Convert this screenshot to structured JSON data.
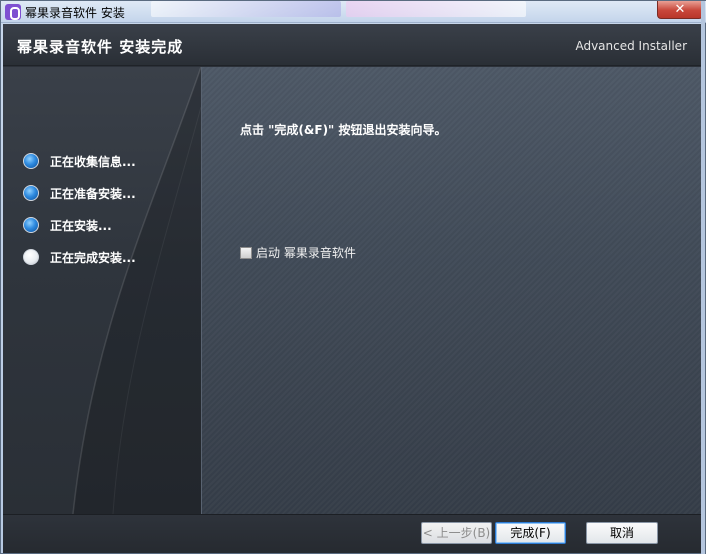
{
  "window": {
    "title": "幂果录音软件 安装",
    "close_label": "✕"
  },
  "header": {
    "title": "幂果录音软件 安装完成",
    "brand": "Advanced Installer"
  },
  "sidebar": {
    "steps": [
      {
        "label": "正在收集信息...",
        "state": "done"
      },
      {
        "label": "正在准备安装...",
        "state": "done"
      },
      {
        "label": "正在安装...",
        "state": "done"
      },
      {
        "label": "正在完成安装...",
        "state": "current"
      }
    ]
  },
  "main": {
    "message": "点击 \"完成(&F)\" 按钮退出安装向导。",
    "launch_checkbox_label": "启动 幂果录音软件",
    "launch_checked": false
  },
  "footer": {
    "back_label": "< 上一步(B)",
    "finish_label": "完成(F)",
    "cancel_label": "取消"
  },
  "colors": {
    "accent": "#2f8be0",
    "panel": "#414b58",
    "header": "#2f353d"
  }
}
